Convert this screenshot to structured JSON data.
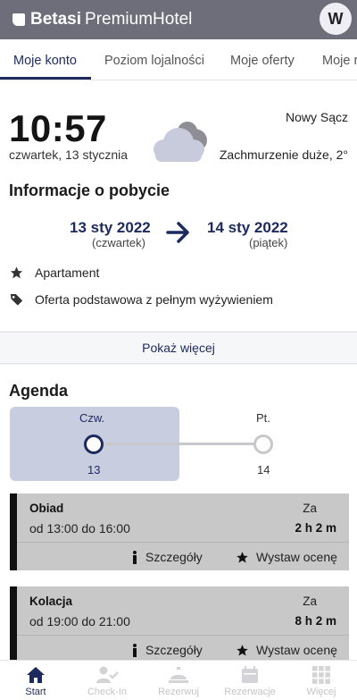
{
  "header": {
    "brand_bold": "Betasi",
    "brand_rest": "PremiumHotel",
    "avatar_initial": "W"
  },
  "tabs": [
    {
      "label": "Moje konto",
      "active": true
    },
    {
      "label": "Poziom lojalności"
    },
    {
      "label": "Moje oferty"
    },
    {
      "label": "Moje r"
    }
  ],
  "weather": {
    "time": "10:57",
    "date": "czwartek, 13 stycznia",
    "city": "Nowy Sącz",
    "conditions": "Zachmurzenie duże, 2°",
    "icon": "cloud-icon"
  },
  "stay": {
    "title": "Informacje o pobycie",
    "from_date": "13 sty 2022",
    "from_day": "(czwartek)",
    "to_date": "14 sty 2022",
    "to_day": "(piątek)",
    "room": "Apartament",
    "offer": "Oferta podstawowa z pełnym wyżywieniem",
    "show_more": "Pokaż więcej"
  },
  "agenda": {
    "title": "Agenda",
    "days": [
      {
        "label": "Czw.",
        "num": "13",
        "selected": true
      },
      {
        "label": "Pt.",
        "num": "14",
        "selected": false
      }
    ],
    "events": [
      {
        "name": "Obiad",
        "hours": "od 13:00 do 16:00",
        "za": "Za",
        "remaining": "2 h 2 m",
        "details": "Szczegóły",
        "rate": "Wystaw ocenę"
      },
      {
        "name": "Kolacja",
        "hours": "od 19:00 do 21:00",
        "za": "Za",
        "remaining": "8 h 2 m",
        "details": "Szczegóły",
        "rate": "Wystaw ocenę"
      }
    ]
  },
  "nav": [
    {
      "label": "Start",
      "icon": "home-icon",
      "active": true
    },
    {
      "label": "Check-In",
      "icon": "user-check-icon"
    },
    {
      "label": "Rezerwuj",
      "icon": "service-bell-icon"
    },
    {
      "label": "Rezerwacje",
      "icon": "calendar-icon"
    },
    {
      "label": "Więcej",
      "icon": "grid-icon"
    }
  ],
  "colors": {
    "header": "#6e6d7a",
    "accent": "#1c2a5e",
    "day_card": "#c9cde0",
    "event_bg": "#c8c8c8"
  }
}
